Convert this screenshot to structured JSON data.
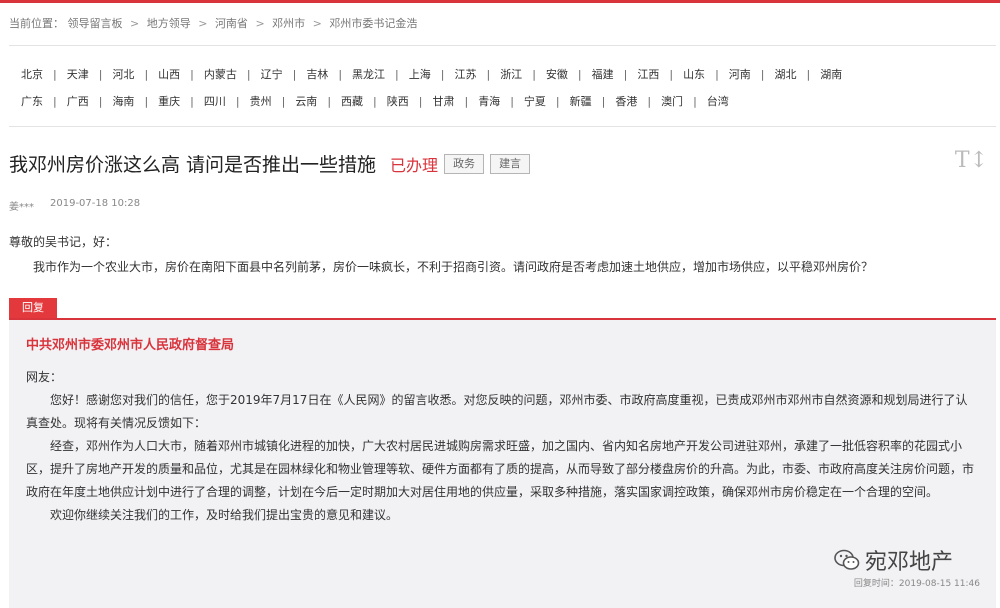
{
  "breadcrumb": {
    "label": "当前位置：",
    "items": [
      "领导留言板",
      "地方领导",
      "河南省",
      "邓州市",
      "邓州市委书记金浩"
    ],
    "separator": ">"
  },
  "provinces": {
    "row1": [
      "北京",
      "天津",
      "河北",
      "山西",
      "内蒙古",
      "辽宁",
      "吉林",
      "黑龙江",
      "上海",
      "江苏",
      "浙江",
      "安徽",
      "福建",
      "江西",
      "山东",
      "河南",
      "湖北",
      "湖南"
    ],
    "row2": [
      "广东",
      "广西",
      "海南",
      "重庆",
      "四川",
      "贵州",
      "云南",
      "西藏",
      "陕西",
      "甘肃",
      "青海",
      "宁夏",
      "新疆",
      "香港",
      "澳门",
      "台湾"
    ]
  },
  "message": {
    "title": "我邓州房价涨这么高 请问是否推出一些措施",
    "status": "已办理",
    "tags": [
      "政务",
      "建言"
    ],
    "font_toggle": "T↕",
    "author": "姜***",
    "date": "2019-07-18 10:28",
    "greeting": "尊敬的吴书记，好：",
    "body": "我市作为一个农业大市，房价在南阳下面县中名列前茅，房价一味疯长，不利于招商引资。请问政府是否考虑加速土地供应，增加市场供应，以平稳邓州房价？"
  },
  "reply": {
    "label": "回复",
    "department": "中共邓州市委邓州市人民政府督查局",
    "salutation": "网友：",
    "paragraphs": [
      "您好！感谢您对我们的信任，您于2019年7月17日在《人民网》的留言收悉。对您反映的问题，邓州市委、市政府高度重视，已责成邓州市邓州市自然资源和规划局进行了认真查处。现将有关情况反馈如下：",
      "经查，邓州作为人口大市，随着邓州市城镇化进程的加快，广大农村居民进城购房需求旺盛，加之国内、省内知名房地产开发公司进驻邓州，承建了一批低容积率的花园式小区，提升了房地产开发的质量和品位，尤其是在园林绿化和物业管理等软、硬件方面都有了质的提高，从而导致了部分楼盘房价的升高。为此，市委、市政府高度关注房价问题，市政府在年度土地供应计划中进行了合理的调整，计划在今后一定时期加大对居住用地的供应量，采取多种措施，落实国家调控政策，确保邓州市房价稳定在一个合理的空间。",
      "欢迎你继续关注我们的工作，及时给我们提出宝贵的意见和建议。"
    ],
    "time": "回复时间：2019-08-15 11:46"
  },
  "watermark": {
    "text": "宛邓地产",
    "icon": "wechat-icon"
  },
  "colors": {
    "accent": "#d9343c",
    "reply_bg": "#f2f2f5"
  }
}
